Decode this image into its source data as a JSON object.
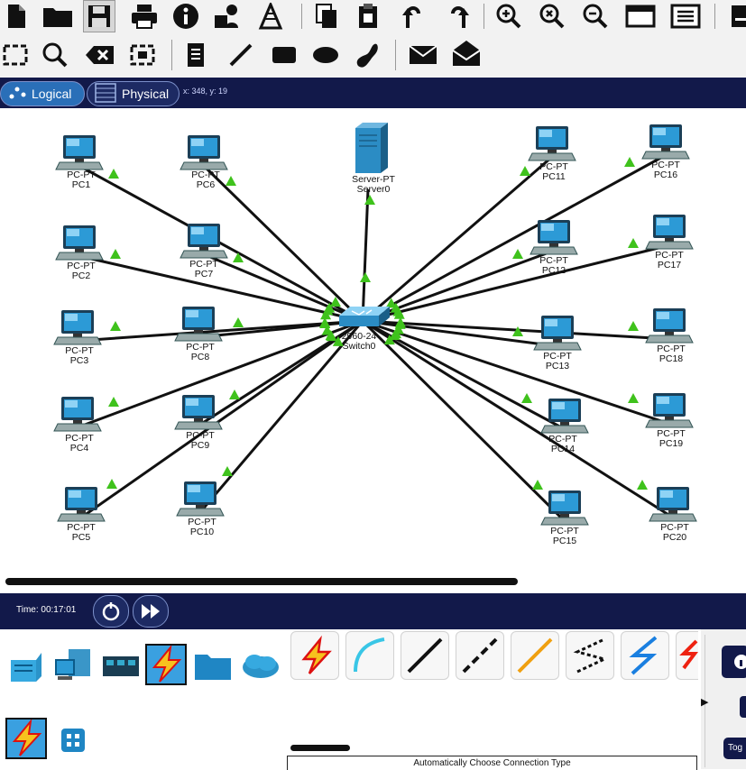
{
  "toolbar_top": {
    "icons": [
      "new-file-icon",
      "open-folder-icon",
      "save-icon",
      "print-icon",
      "info-icon",
      "user-admin-icon",
      "network-info-icon",
      "copy-icon",
      "paste-icon",
      "undo-icon",
      "redo-icon",
      "zoom-in-icon",
      "zoom-reset-icon",
      "zoom-out-icon",
      "palette-icon",
      "custom-device-icon",
      "extra-icon"
    ]
  },
  "toolbar_edit": {
    "icons": [
      "select-icon",
      "inspect-icon",
      "delete-icon",
      "resize-icon",
      "note-icon",
      "draw-line-icon",
      "draw-rectangle-icon",
      "draw-ellipse-icon",
      "freeform-icon",
      "simple-pdu-icon",
      "complex-pdu-icon"
    ]
  },
  "mode": {
    "logical_label": "Logical",
    "physical_label": "Physical",
    "coords": "x: 348, y: 19"
  },
  "devices": {
    "server": {
      "type": "Server-PT",
      "name": "Server0"
    },
    "switch": {
      "type": "2960-24",
      "name": "Switch0"
    },
    "pcs": [
      {
        "type": "PC-PT",
        "name": "PC1"
      },
      {
        "type": "PC-PT",
        "name": "PC2"
      },
      {
        "type": "PC-PT",
        "name": "PC3"
      },
      {
        "type": "PC-PT",
        "name": "PC4"
      },
      {
        "type": "PC-PT",
        "name": "PC5"
      },
      {
        "type": "PC-PT",
        "name": "PC6"
      },
      {
        "type": "PC-PT",
        "name": "PC7"
      },
      {
        "type": "PC-PT",
        "name": "PC8"
      },
      {
        "type": "PC-PT",
        "name": "PC9"
      },
      {
        "type": "PC-PT",
        "name": "PC10"
      },
      {
        "type": "PC-PT",
        "name": "PC11"
      },
      {
        "type": "PC-PT",
        "name": "PC12"
      },
      {
        "type": "PC-PT",
        "name": "PC13"
      },
      {
        "type": "PC-PT",
        "name": "PC14"
      },
      {
        "type": "PC-PT",
        "name": "PC15"
      },
      {
        "type": "PC-PT",
        "name": "PC16"
      },
      {
        "type": "PC-PT",
        "name": "PC17"
      },
      {
        "type": "PC-PT",
        "name": "PC18"
      },
      {
        "type": "PC-PT",
        "name": "PC19"
      },
      {
        "type": "PC-PT",
        "name": "PC20"
      }
    ]
  },
  "realtime": {
    "time_label": "Time: 00:17:01"
  },
  "device_categories": [
    "network-devices-icon",
    "end-devices-icon",
    "components-icon",
    "connections-icon",
    "misc-icon",
    "multiuser-icon"
  ],
  "connection_types": [
    "auto-connection-icon",
    "console-cable-icon",
    "straight-through-icon",
    "crossover-icon",
    "fiber-icon",
    "phone-cable-icon",
    "coaxial-icon",
    "serial-icon"
  ],
  "status": {
    "text": "Automatically Choose Connection Type",
    "toggle_label": "Tog"
  },
  "colors": {
    "navy": "#12194a",
    "link": "#111111",
    "link_light": "#3fc21c",
    "accent_blue": "#2a6fb8",
    "pc_screen": "#2c9ad6"
  }
}
